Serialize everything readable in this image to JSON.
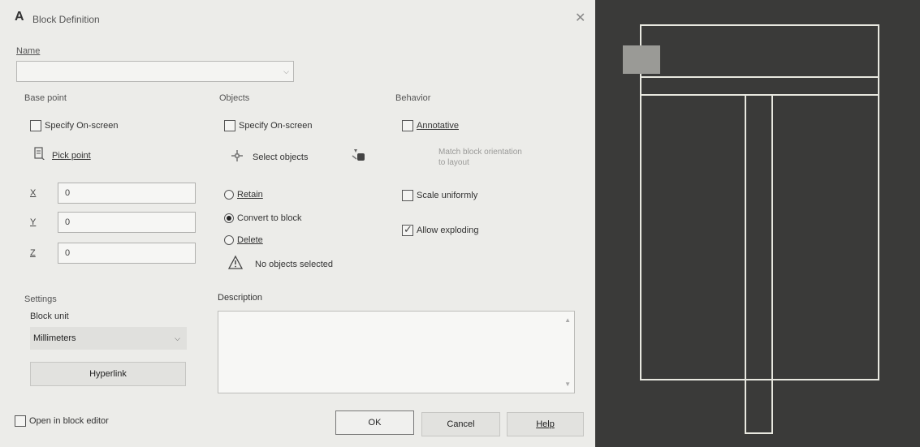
{
  "window": {
    "title": "Block Definition",
    "close_glyph": "✕"
  },
  "name": {
    "label": "Name",
    "value": ""
  },
  "base_point": {
    "heading": "Base point",
    "specify_label": "Specify On-screen",
    "pick_label": "Pick point",
    "x_label": "X",
    "y_label": "Y",
    "z_label": "Z",
    "x_value": "0",
    "y_value": "0",
    "z_value": "0"
  },
  "objects": {
    "heading": "Objects",
    "specify_label": "Specify On-screen",
    "select_label": "Select objects",
    "retain_label": "Retain",
    "convert_label": "Convert to block",
    "delete_label": "Delete",
    "status": "No objects selected"
  },
  "behavior": {
    "heading": "Behavior",
    "annotative_label": "Annotative",
    "match_line1": "Match block orientation",
    "match_line2": "to layout",
    "scale_label": "Scale uniformly",
    "explode_label": "Allow exploding",
    "explode_checked": true
  },
  "settings": {
    "heading": "Settings",
    "unit_label": "Block unit",
    "unit_value": "Millimeters",
    "hyperlink_label": "Hyperlink"
  },
  "description": {
    "label": "Description",
    "value": ""
  },
  "footer": {
    "open_editor_label": "Open in block editor",
    "ok_label": "OK",
    "cancel_label": "Cancel",
    "help_label": "Help"
  },
  "icons": {
    "pick_point": "pick-point-icon",
    "select_objects": "select-objects-icon",
    "quick_select": "quick-select-icon",
    "warning": "warning-icon"
  },
  "colors": {
    "dialog_bg": "#ecece9",
    "preview_bg": "#3a3a39",
    "preview_lines": "#e8e8e0",
    "preview_swatch": "#9a9a96"
  }
}
